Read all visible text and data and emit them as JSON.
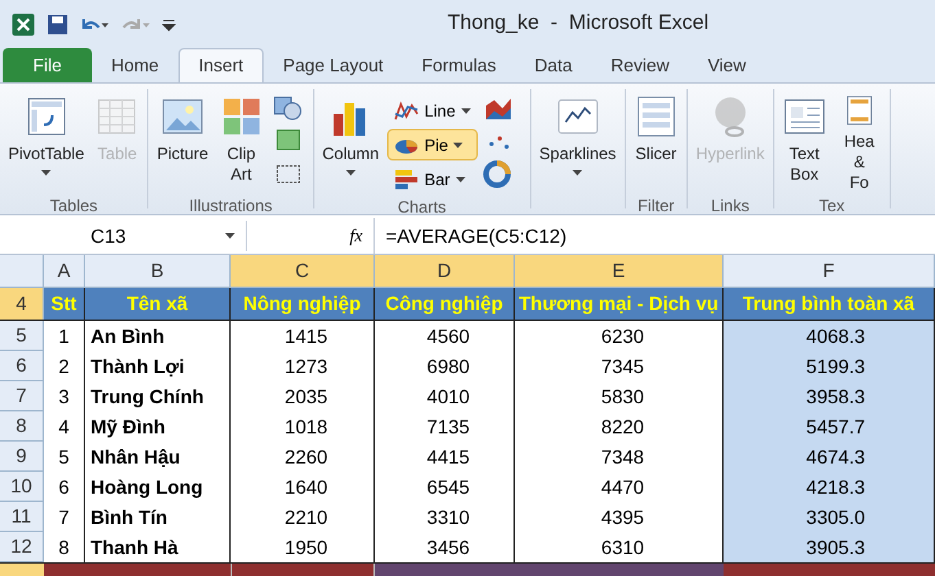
{
  "window": {
    "title": "Thong_ke  -  Microsoft Excel"
  },
  "ribbon_tabs": [
    {
      "label": "File",
      "kind": "file",
      "selected": false
    },
    {
      "label": "Home",
      "kind": "tab",
      "selected": false
    },
    {
      "label": "Insert",
      "kind": "tab",
      "selected": true
    },
    {
      "label": "Page Layout",
      "kind": "tab",
      "selected": false
    },
    {
      "label": "Formulas",
      "kind": "tab",
      "selected": false
    },
    {
      "label": "Data",
      "kind": "tab",
      "selected": false
    },
    {
      "label": "Review",
      "kind": "tab",
      "selected": false
    },
    {
      "label": "View",
      "kind": "tab",
      "selected": false
    }
  ],
  "ribbon_groups": [
    {
      "label": "Tables",
      "items": [
        {
          "label": "PivotTable",
          "disabled": false,
          "dropdown": true
        },
        {
          "label": "Table",
          "disabled": true,
          "dropdown": false
        }
      ]
    },
    {
      "label": "Illustrations",
      "items": [
        {
          "label": "Picture",
          "disabled": false,
          "dropdown": false
        },
        {
          "label": "Clip Art",
          "disabled": false,
          "dropdown": false
        }
      ]
    },
    {
      "label": "Charts",
      "items": [
        {
          "label": "Column",
          "disabled": false,
          "dropdown": true
        },
        {
          "label": "Line",
          "selected": false
        },
        {
          "label": "Pie",
          "selected": true
        },
        {
          "label": "Bar",
          "selected": false
        }
      ]
    },
    {
      "items": [
        {
          "label": "Sparklines",
          "disabled": false,
          "dropdown": true
        }
      ]
    },
    {
      "label": "Filter",
      "items": [
        {
          "label": "Slicer",
          "disabled": false,
          "dropdown": false
        }
      ]
    },
    {
      "label": "Links",
      "items": [
        {
          "label": "Hyperlink",
          "disabled": true,
          "dropdown": false
        }
      ]
    },
    {
      "label": "Tex",
      "items": [
        {
          "label": "Text Box",
          "disabled": false,
          "dropdown": false
        },
        {
          "label": "Hea & Fo",
          "disabled": false,
          "dropdown": false
        }
      ]
    }
  ],
  "formula_bar": {
    "name_box": "C13",
    "fx": "fx",
    "formula": "=AVERAGE(C5:C12)"
  },
  "columns": [
    {
      "label": "A",
      "selected": false
    },
    {
      "label": "B",
      "selected": false
    },
    {
      "label": "C",
      "selected": true
    },
    {
      "label": "D",
      "selected": true
    },
    {
      "label": "E",
      "selected": true
    },
    {
      "label": "F",
      "selected": false
    }
  ],
  "header_row": {
    "number": "4",
    "selected": true,
    "cells": [
      "Stt",
      "Tên xã",
      "Nông nghiệp",
      "Công nghiệp",
      "Thương mại - Dịch vụ",
      "Trung bình toàn xã"
    ]
  },
  "rows": [
    {
      "number": "5",
      "cells": [
        "1",
        "An Bình",
        "1415",
        "4560",
        "6230",
        "4068.3"
      ]
    },
    {
      "number": "6",
      "cells": [
        "2",
        "Thành Lợi",
        "1273",
        "6980",
        "7345",
        "5199.3"
      ]
    },
    {
      "number": "7",
      "cells": [
        "3",
        "Trung Chính",
        "2035",
        "4010",
        "5830",
        "3958.3"
      ]
    },
    {
      "number": "8",
      "cells": [
        "4",
        "Mỹ Đình",
        "1018",
        "7135",
        "8220",
        "5457.7"
      ]
    },
    {
      "number": "9",
      "cells": [
        "5",
        "Nhân Hậu",
        "2260",
        "4415",
        "7348",
        "4674.3"
      ]
    },
    {
      "number": "10",
      "cells": [
        "6",
        "Hoàng Long",
        "1640",
        "6545",
        "4470",
        "4218.3"
      ]
    },
    {
      "number": "11",
      "cells": [
        "7",
        "Bình Tín",
        "2210",
        "3310",
        "4395",
        "3305.0"
      ]
    },
    {
      "number": "12",
      "cells": [
        "8",
        "Thanh Hà",
        "1950",
        "3456",
        "6310",
        "3905.3"
      ]
    }
  ]
}
